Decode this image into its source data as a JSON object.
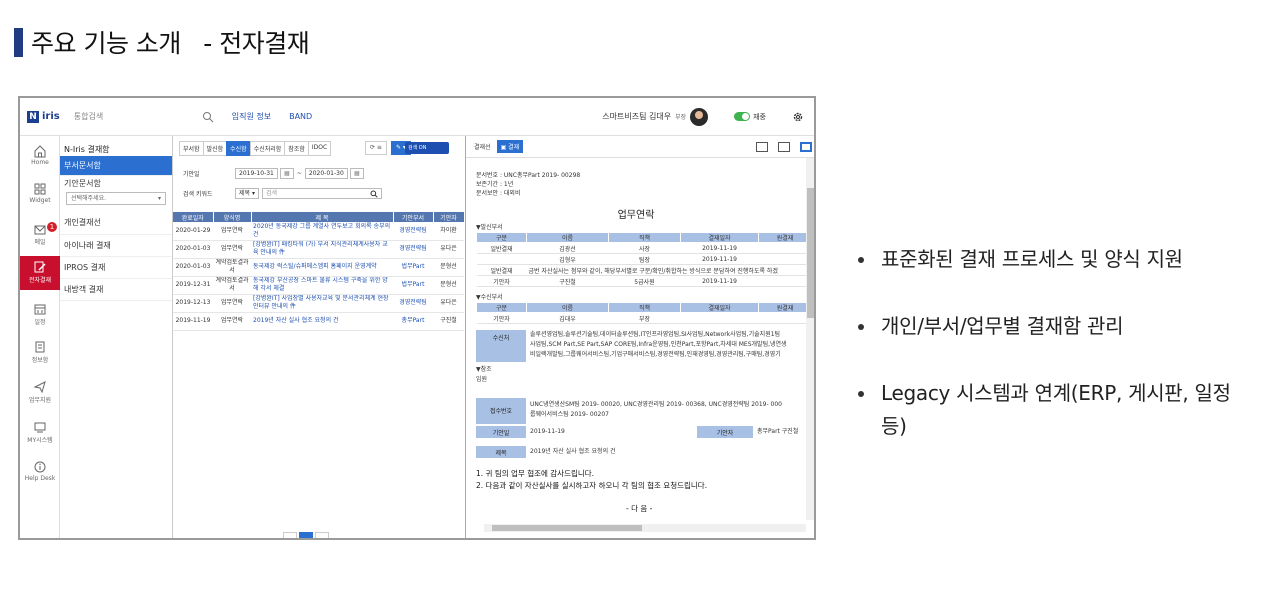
{
  "page": {
    "title": "주요 기능 소개   - 전자결재"
  },
  "app": {
    "logo_letter": "N",
    "logo_text": "iris",
    "search_placeholder": "통합검색",
    "links": [
      "임직원 정보",
      "BAND"
    ],
    "user_name": "스마트비즈팀 김대우",
    "user_rank": "부장",
    "status_label": "재중"
  },
  "nav": {
    "items": [
      "Home",
      "Widget",
      "메일",
      "전자결재",
      "일정",
      "정보함",
      "업무지원",
      "MY시스템",
      "Help Desk"
    ],
    "mail_badge": "1"
  },
  "folders": {
    "title": "N-Iris 결재함",
    "items": [
      "부서문서함",
      "기안문서함"
    ],
    "select_placeholder": "선택해주세요.",
    "others": [
      "개인결재선",
      "아이나래 결재",
      "IPROS 결재",
      "내방객 결재"
    ]
  },
  "list": {
    "tabs": [
      "부서함",
      "발신함",
      "수신함",
      "수신처리함",
      "참조함",
      "IDOC"
    ],
    "selected_tab": 2,
    "toggle_label": "검색 ON",
    "date_label": "기안일",
    "date_from": "2019-10-31",
    "date_to": "2020-01-30",
    "keyword_label": "검색 키워드",
    "keyword_select": "제목",
    "keyword_placeholder": "검색",
    "columns": [
      "완료일자",
      "양식명",
      "제 목",
      "기안부서",
      "기안자"
    ],
    "rows": [
      [
        "2020-01-29",
        "업무연락",
        "2020년 동국제강 그룹 계열사 연두보고 회의록 송부의 건",
        "경영전략팀",
        "차이환"
      ],
      [
        "2020-01-03",
        "업무연락",
        "[강병완IT] 패킹타워 (가) 부서 지식관리체계사용자 교육 안내의 件",
        "경영전략팀",
        "유다은"
      ],
      [
        "2020-01-03",
        "계약검토결과서",
        "동국제강 럭스틸/슈퍼메스엠피 홈페이지 운영계약",
        "법무Part",
        "문형선"
      ],
      [
        "2019-12-31",
        "계약검토결과서",
        "동국제강 부산공장 스마트 물류 시스템 구축을 위한 양해 각서 체결",
        "법무Part",
        "문형선"
      ],
      [
        "2019-12-13",
        "업무연락",
        "[강병완IT] 사업장별 사용자교육 및 문서관리체계 현장인터뷰 안내의 件",
        "경영전략팀",
        "유다은"
      ],
      [
        "2019-11-19",
        "업무연락",
        "2019년 자산 실사 협조 요청의 건",
        "총무Part",
        "구진철"
      ]
    ]
  },
  "doc": {
    "toolbar_label": "결재선",
    "approve_label": "결재",
    "doc_no": "문서번호 :  UNC총무Part 2019- 00298",
    "retention": "보존기간 :  1년",
    "security": "문서보안 :  대외비",
    "title": "업무연락",
    "sender_section": "▼발신부서",
    "approval_cols": [
      "구분",
      "이름",
      "직책",
      "결재일자",
      "원결재"
    ],
    "sender_rows": [
      [
        "일반결재",
        "김광선",
        "사장",
        "2019-11-19",
        ""
      ],
      [
        "",
        "김형우",
        "팀장",
        "2019-11-19",
        ""
      ],
      [
        "일반결재",
        "금번 자산실사는 첨부와 같이, 해당부서별로 구분/확인/취합하는 방식으로 분담하여 진행하도록 하겠",
        "",
        "",
        ""
      ],
      [
        "기안자",
        "구진철",
        "5급사원",
        "2019-11-19",
        ""
      ]
    ],
    "receiver_section": "▼수신부서",
    "receiver_rows": [
      [
        "기안자",
        "김대우",
        "부장",
        "",
        ""
      ]
    ],
    "recv_label": "수신처",
    "recv_lines": [
      "솔루션영업팀,솔루션기술팀,데이터솔루션팀,IT인프라영업팀,SI사업팀,Network사업팀,기술지원1팀",
      "사업팀,SCM Part,SE Part,SAP CORE팀,Infra운영팀,인천Part,포항Part,차세대 MES개발팀,냉연생",
      "비일렉개발팀,그룹웨어서비스팀,기업구매서비스팀,경영전략팀,인재경영팀,경영관리팀,구매팀,경영기"
    ],
    "ref_section": "▼참조",
    "ref_value": "임원",
    "receipt_label": "접수번호",
    "receipt_lines": [
      "UNC냉연생산SM팀 2019- 00020, UNC경영관리팀 2019- 00368, UNC경영전략팀 2019- 000",
      "룹웨어서비스팀 2019- 00207"
    ],
    "draft_date_label": "기안일",
    "draft_date": "2019-11-19",
    "drafter_label": "기안자",
    "drafter": "총무Part 구진철",
    "subject_label": "제목",
    "subject": "2019년 자산 실사 협조 요청의 건",
    "body_lines": [
      "1. 귀 팀의 업무 협조에 감사드립니다.",
      "2. 다음과 같이 자산실사를 실시하고자 하오니 각 팀의 협조 요청드립니다.",
      "-  다           음  -"
    ]
  },
  "bullets": [
    "표준화된 결재 프로세스 및 양식 지원",
    "개인/부서/업무별 결재함 관리",
    "Legacy 시스템과 연계(ERP, 게시판, 일정 등)"
  ]
}
